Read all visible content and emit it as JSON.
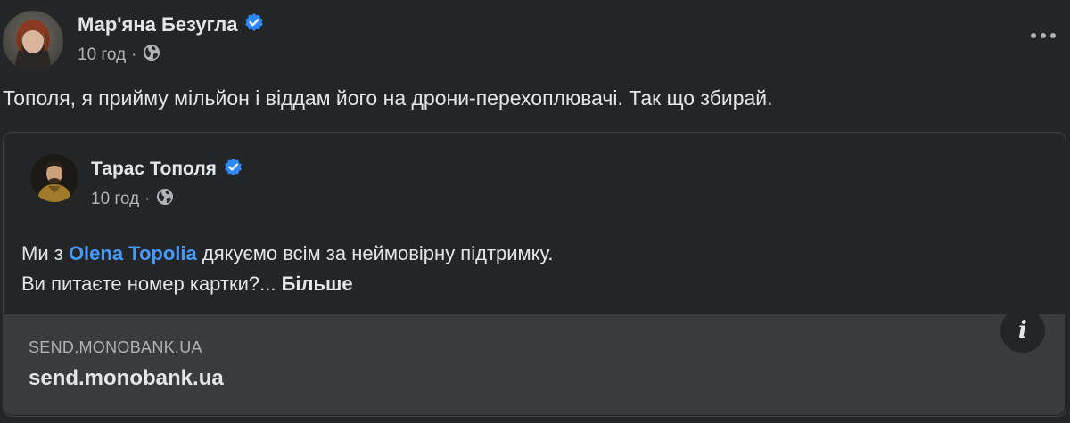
{
  "post": {
    "author": "Мар'яна Безугла",
    "time": "10 год",
    "dot": "·",
    "text": "Тополя, я прийму мільйон і віддам його на дрони-перехоплювачі. Так що збирай.",
    "audience_icon": "globe-icon",
    "options_icon": "more-options-icon"
  },
  "shared": {
    "author": "Тарас Тополя",
    "time": "10 год",
    "dot": "·",
    "text_prefix": "Ми з ",
    "mention": "Olena Topolia",
    "text_suffix": " дякуємо всім за неймовірну підтримку.",
    "line2": "Ви питаєте номер картки?... ",
    "more_label": "Більше"
  },
  "link": {
    "domain": "SEND.MONOBANK.UA",
    "title": "send.monobank.ua",
    "info_label": "i"
  },
  "colors": {
    "background": "#242526",
    "verified": "#2e89ff",
    "mention": "#4599ff",
    "link_box": "#3a3b3c"
  }
}
